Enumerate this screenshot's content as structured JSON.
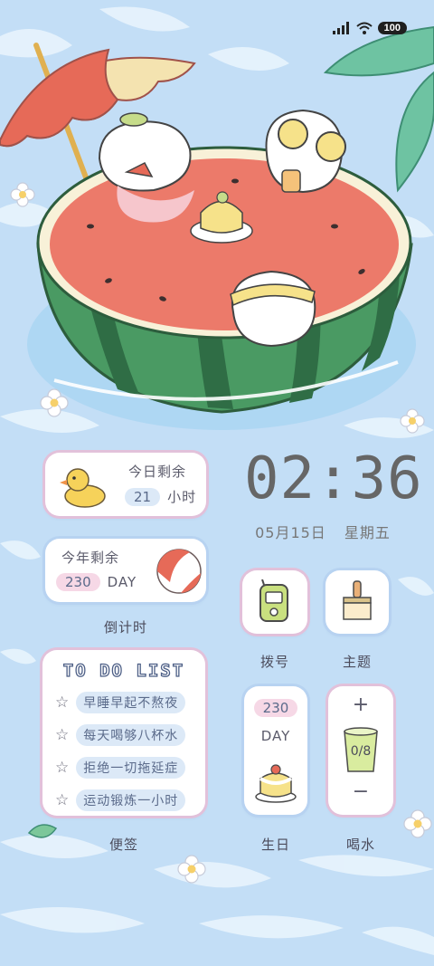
{
  "status_bar": {
    "battery": "100"
  },
  "countdown_widget": {
    "today_label": "今日剩余",
    "today_value": "21",
    "today_unit": "小时",
    "year_label": "今年剩余",
    "year_value": "230",
    "year_unit": "DAY",
    "caption": "倒计时"
  },
  "clock_widget": {
    "time": "02:36",
    "date": "05月15日",
    "weekday": "星期五"
  },
  "dial_app": {
    "caption": "拨号"
  },
  "theme_app": {
    "caption": "主题"
  },
  "todo_widget": {
    "title": "TO DO LIST",
    "items": [
      "早睡早起不熬夜",
      "每天喝够八杯水",
      "拒绝一切拖延症",
      "运动锻炼一小时"
    ],
    "caption": "便签"
  },
  "birthday_widget": {
    "value": "230",
    "unit": "DAY",
    "caption": "生日"
  },
  "water_widget": {
    "plus": "+",
    "count": "0/8",
    "minus": "−",
    "caption": "喝水"
  },
  "colors": {
    "water": "#bfdcf5",
    "card_border_pink": "#e6bed7",
    "card_border_blue": "#b6d2f0",
    "melon_flesh": "#ec7a6a"
  }
}
